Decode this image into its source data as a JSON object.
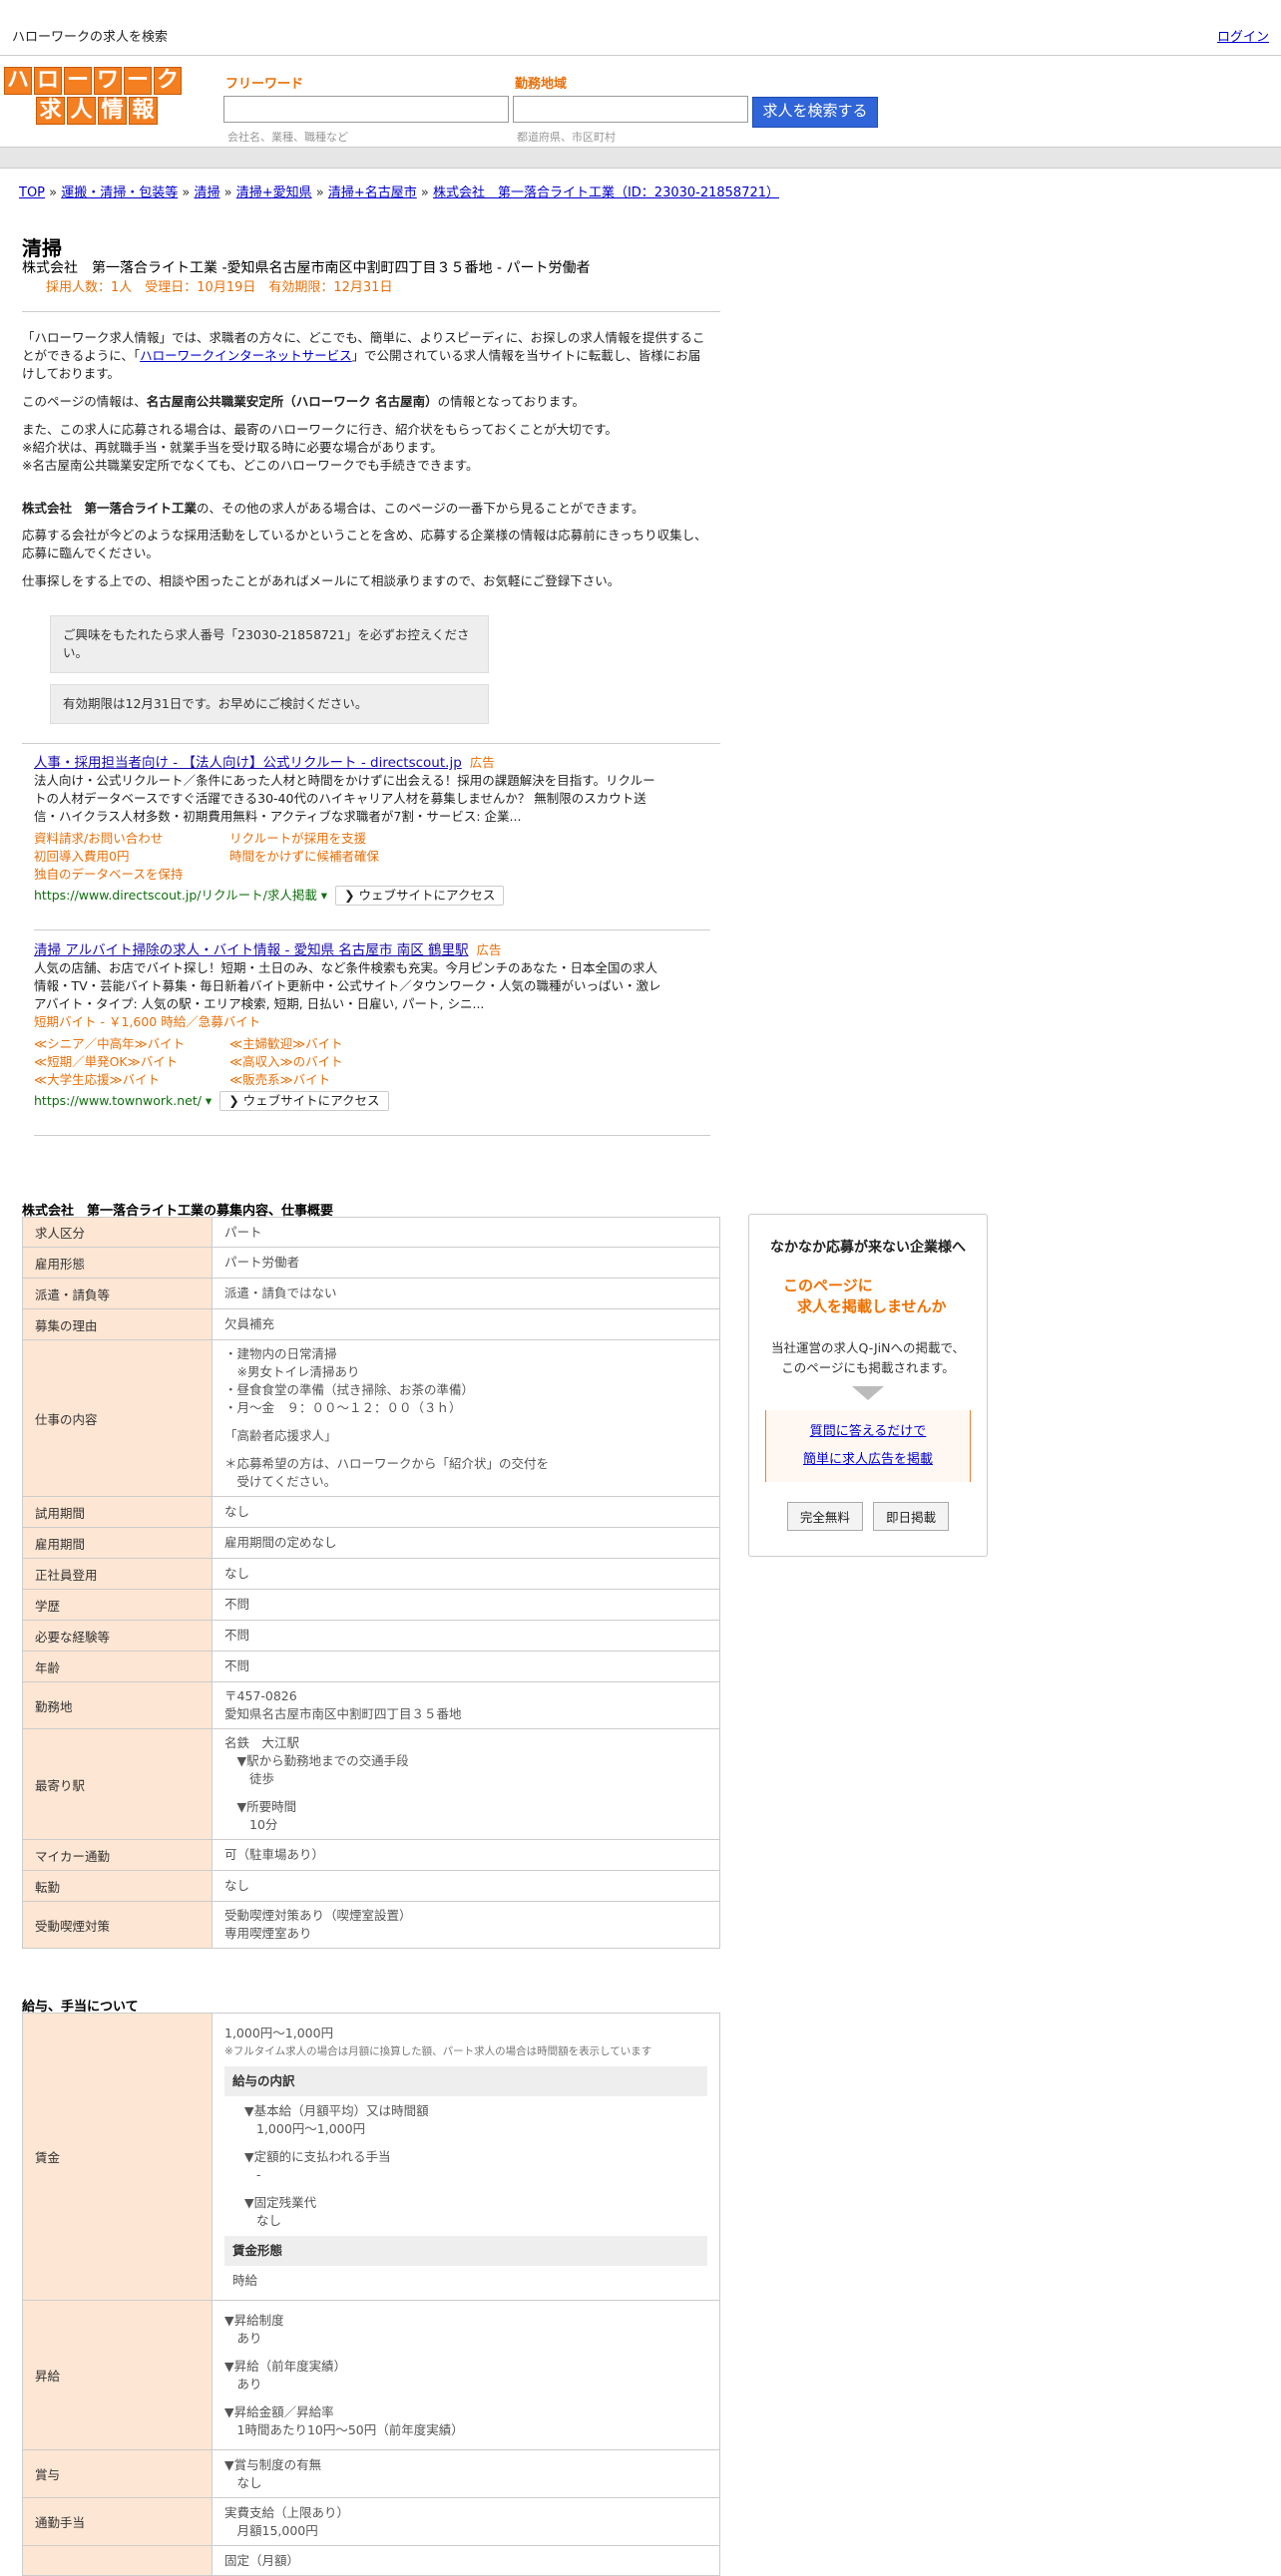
{
  "header": {
    "site_title": "ハローワークの求人を検索",
    "login": "ログイン",
    "logo_row1": [
      "ハ",
      "ロ",
      "ー",
      "ワ",
      "ー",
      "ク"
    ],
    "logo_row2": [
      "求",
      "人",
      "情",
      "報"
    ],
    "freeword_label": "フリーワード",
    "freeword_hint": "会社名、業種、職種など",
    "area_label": "勤務地域",
    "area_hint": "都道府県、市区町村",
    "search_button": "求人を検索する"
  },
  "breadcrumb": [
    "TOP",
    "運搬・清掃・包装等",
    "清掃",
    "清掃+愛知県",
    "清掃+名古屋市",
    "株式会社　第一落合ライト工業（ID：23030-21858721）"
  ],
  "breadcrumb_sep": "»",
  "job": {
    "title": "清掃",
    "subtitle": "株式会社　第一落合ライト工業 -愛知県名古屋市南区中割町四丁目３５番地 - パート労働者",
    "meta": "採用人数：1人　受理日：10月19日　有効期限：12月31日"
  },
  "intro": {
    "p1_a": "「ハローワーク求人情報」では、求職者の方々に、どこでも、簡単に、よりスピーディに、お探しの求人情報を提供することができるように、「",
    "p1_link": "ハローワークインターネットサービス",
    "p1_b": "」で公開されている求人情報を当サイトに転載し、皆様にお届けしております。",
    "p2_a": "このページの情報は、",
    "p2_bold": "名古屋南公共職業安定所（ハローワーク 名古屋南）",
    "p2_b": "の情報となっております。",
    "p3_1": "また、この求人に応募される場合は、最寄のハローワークに行き、紹介状をもらっておくことが大切です。",
    "p3_2": "※紹介状は、再就職手当・就業手当を受け取る時に必要な場合があります。",
    "p3_3": "※名古屋南公共職業安定所でなくても、どこのハローワークでも手続きできます。",
    "p4_bold": "株式会社　第一落合ライト工業",
    "p4_b": "の、その他の求人がある場合は、このページの一番下から見ることができます。",
    "p5": "応募する会社が今どのような採用活動をしているかということを含め、応募する企業様の情報は応募前にきっちり収集し、応募に臨んでください。",
    "p6": "仕事探しをする上での、相談や困ったことがあればメールにて相談承りますので、お気軽にご登録下さい。",
    "notice1": "ご興味をもたれたら求人番号「23030-21858721」を必ずお控えください。",
    "notice2": "有効期限は12月31日です。お早めにご検討ください。"
  },
  "ads": [
    {
      "title": "人事・採用担当者向け - 【法人向け】公式リクルート - directscout.jp",
      "tag": "広告",
      "desc": "法人向け・公式リクルート／条件にあった人材と時間をかけずに出会える！採用の課題解決を目指す。リクルートの人材データベースですぐ活躍できる30-40代のハイキャリア人材を募集しませんか？ 無制限のスカウト送信・ハイクラス人材多数・初期費用無料・アクティブな求職者が7割・サービス: 企業...",
      "extra": "",
      "links": [
        "資料請求/お問い合わせ",
        "リクルートが採用を支援",
        "初回導入費用0円",
        "時間をかけずに候補者確保",
        "独自のデータベースを保持",
        ""
      ],
      "url": "https://www.directscout.jp/リクルート/求人掲載 ▾",
      "visit": "❯ ウェブサイトにアクセス"
    },
    {
      "title": "清掃 アルバイト掃除の求人・バイト情報 - 愛知県 名古屋市 南区 鶴里駅",
      "tag": "広告",
      "desc": "人気の店舗、お店でバイト探し！短期・土日のみ、など条件検索も充実。今月ピンチのあなた・日本全国の求人情報・TV・芸能バイト募集・毎日新着バイト更新中・公式サイト／タウンワーク・人気の職種がいっぱい・激レアバイト・タイプ: 人気の駅・エリア検索, 短期, 日払い・日雇い, パート, シニ...",
      "extra": "短期バイト - ￥1,600 時給／急募バイト",
      "links": [
        "≪シニア／中高年≫バイト",
        "≪主婦歓迎≫バイト",
        "≪短期／単発OK≫バイト",
        "≪高収入≫のバイト",
        "≪大学生応援≫バイト",
        "≪販売系≫バイト"
      ],
      "url": "https://www.townwork.net/ ▾",
      "visit": "❯ ウェブサイトにアクセス"
    }
  ],
  "details": {
    "section_title": "株式会社　第一落合ライト工業の募集内容、仕事概要",
    "rows": [
      {
        "label": "求人区分",
        "lines": [
          "パート"
        ]
      },
      {
        "label": "雇用形態",
        "lines": [
          "パート労働者"
        ]
      },
      {
        "label": "派遣・請負等",
        "lines": [
          "派遣・請負ではない"
        ]
      },
      {
        "label": "募集の理由",
        "lines": [
          "欠員補充"
        ]
      },
      {
        "label": "仕事の内容",
        "lines": [
          "・建物内の日常清掃",
          "　※男女トイレ清掃あり",
          "・昼食食堂の準備（拭き掃除、お茶の準備）",
          "・月～金　９：００～１２：００（３ｈ）",
          "",
          "「高齢者応援求人」",
          "",
          "＊応募希望の方は、ハローワークから「紹介状」の交付を",
          "　受けてください。"
        ]
      },
      {
        "label": "試用期間",
        "lines": [
          "なし"
        ]
      },
      {
        "label": "雇用期間",
        "lines": [
          "雇用期間の定めなし"
        ]
      },
      {
        "label": "正社員登用",
        "lines": [
          "なし"
        ]
      },
      {
        "label": "学歴",
        "lines": [
          "不問"
        ]
      },
      {
        "label": "必要な経験等",
        "lines": [
          "不問"
        ]
      },
      {
        "label": "年齢",
        "lines": [
          "不問"
        ]
      },
      {
        "label": "勤務地",
        "lines": [
          "〒457-0826",
          "愛知県名古屋市南区中割町四丁目３５番地"
        ]
      },
      {
        "label": "最寄り駅",
        "lines": [
          "名鉄　大江駅",
          "　▼駅から勤務地までの交通手段",
          "　　徒歩",
          "",
          "　▼所要時間",
          "　　10分"
        ]
      },
      {
        "label": "マイカー通勤",
        "lines": [
          "可（駐車場あり）"
        ]
      },
      {
        "label": "転勤",
        "lines": [
          "なし"
        ]
      },
      {
        "label": "受動喫煙対策",
        "lines": [
          "受動喫煙対策あり（喫煙室設置）",
          "専用喫煙室あり"
        ]
      }
    ]
  },
  "salary": {
    "section_title": "給与、手当について",
    "wage_label": "賃金",
    "wage_amount": "1,000円〜1,000円",
    "wage_note": "※フルタイム求人の場合は月額に換算した額、パート求人の場合は時間額を表示しています",
    "breakdown_head": "給与の内訳",
    "base_label": "▼基本給（月額平均）又は時間額",
    "base_value": "1,000円〜1,000円",
    "fixed_label": "▼定額的に支払われる手当",
    "fixed_value": "-",
    "ot_label": "▼固定残業代",
    "ot_value": "なし",
    "form_head": "賃金形態",
    "form_value": "時給",
    "raise_label": "昇給",
    "raise_lines": [
      "▼昇給制度",
      "　あり",
      "",
      "▼昇給（前年度実績）",
      "　あり",
      "",
      "▼昇給金額／昇給率",
      "　1時間あたり10円〜50円（前年度実績）"
    ],
    "bonus_label": "賞与",
    "bonus_lines": [
      "▼賞与制度の有無",
      "　なし"
    ],
    "commute_label": "通勤手当",
    "commute_lines": [
      "実費支給（上限あり）",
      "　月額15,000円"
    ],
    "next_row_partial": "固定（月額）"
  },
  "sidebox": {
    "title": "なかなか応募が来ない企業様へ",
    "catch1": "このページに",
    "catch2": "求人を掲載しませんか",
    "desc1": "当社運営の求人Q-JiNへの掲載で、",
    "desc2": "このページにも掲載されます。",
    "link1": "質問に答えるだけで",
    "link2": "簡単に求人広告を掲載",
    "btn_free": "完全無料",
    "btn_instant": "即日掲載"
  }
}
